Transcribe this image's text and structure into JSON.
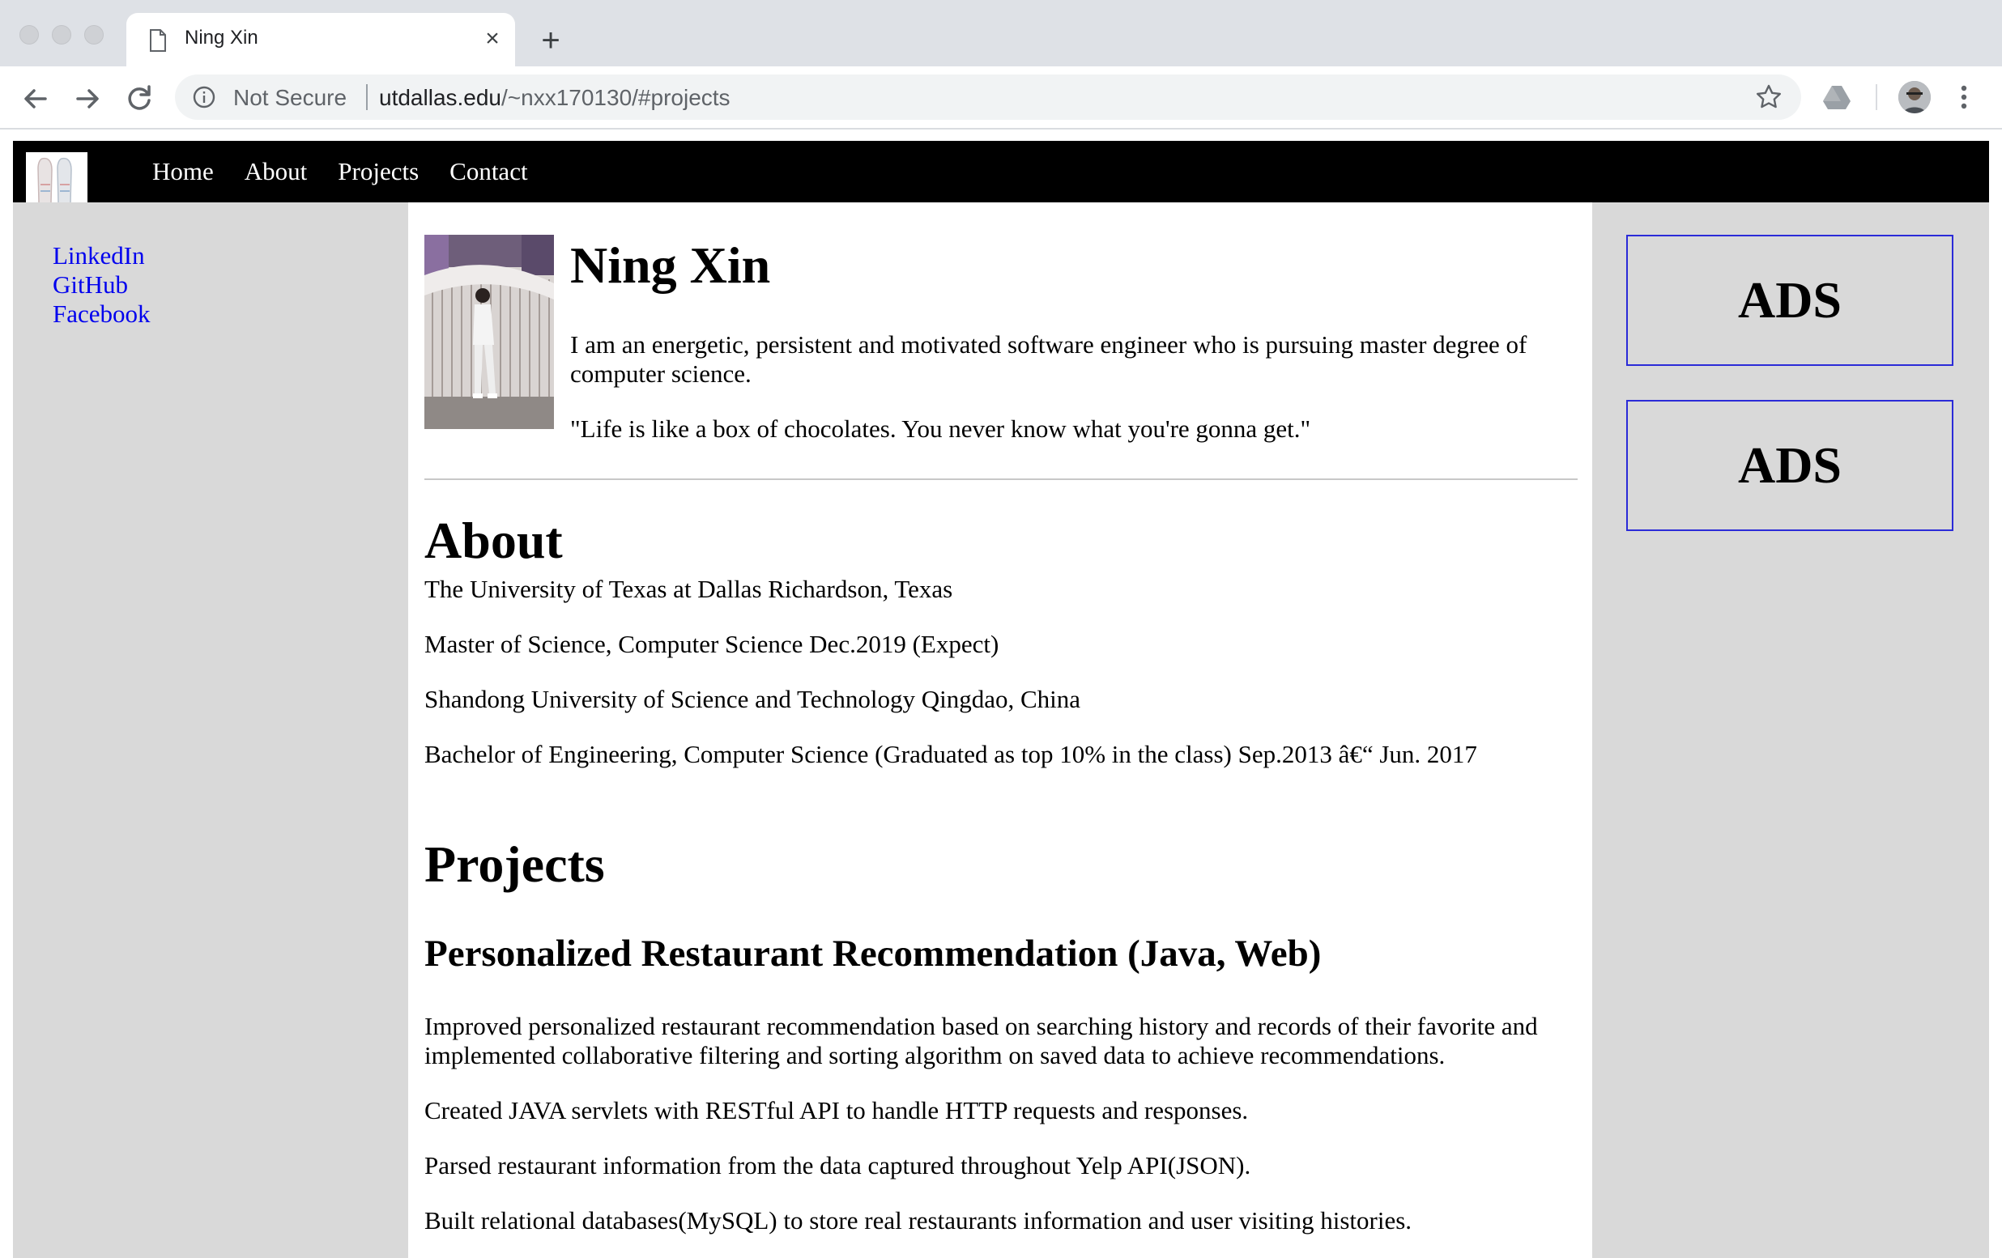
{
  "browser": {
    "tab_title": "Ning Xin",
    "tab_close": "×",
    "new_tab": "+",
    "security_label": "Not Secure",
    "url_host": "utdallas.edu",
    "url_rest": "/~nxx170130/#projects"
  },
  "nav": {
    "links": [
      "Home",
      "About",
      "Projects",
      "Contact"
    ]
  },
  "social": {
    "links": [
      "LinkedIn",
      "GitHub",
      "Facebook"
    ]
  },
  "ads": [
    "ADS",
    "ADS"
  ],
  "profile": {
    "name": "Ning Xin",
    "bio": "I am an energetic, persistent and motivated software engineer who is pursuing master degree of computer science.",
    "quote": "\"Life is like a box of chocolates. You never know what you're gonna get.\""
  },
  "about": {
    "heading": "About",
    "education": [
      "The University of Texas at Dallas Richardson, Texas",
      "Master of Science, Computer Science Dec.2019 (Expect)",
      "Shandong University of Science and Technology Qingdao, China",
      "Bachelor of Engineering, Computer Science (Graduated as top 10% in the class) Sep.2013 â€“ Jun. 2017"
    ]
  },
  "projects": {
    "heading": "Projects",
    "items": [
      {
        "title": "Personalized Restaurant Recommendation (Java, Web)",
        "bullets": [
          "Improved personalized restaurant recommendation based on searching history and records of their favorite and implemented collaborative filtering and sorting algorithm on saved data to achieve recommendations.",
          "Created JAVA servlets with RESTful API to handle HTTP requests and responses.",
          "Parsed restaurant information from the data captured throughout Yelp API(JSON).",
          "Built relational databases(MySQL) to store real restaurants information and user visiting histories."
        ]
      }
    ]
  }
}
